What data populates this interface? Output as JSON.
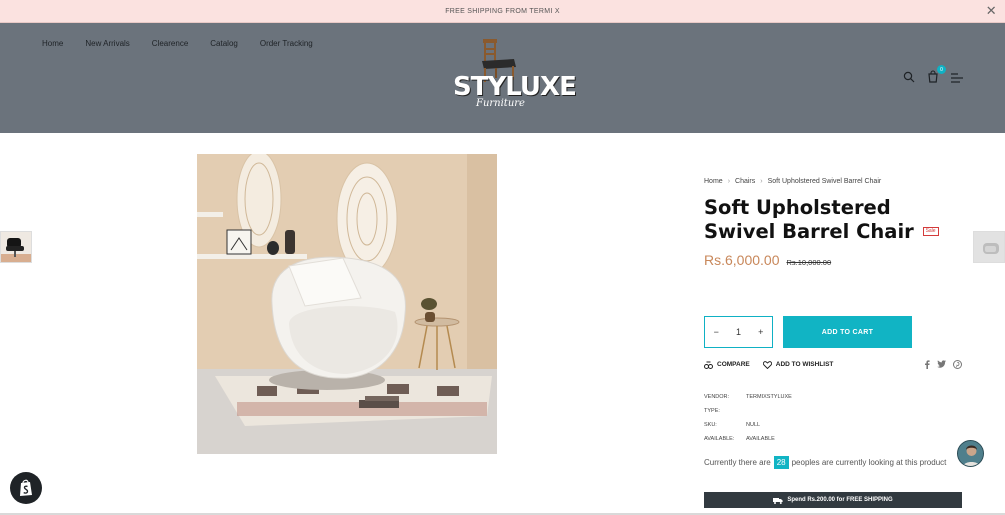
{
  "announcement": {
    "text": "FREE SHIPPING FROM TERMI X",
    "close_icon": "close-icon"
  },
  "nav": {
    "items": [
      "Home",
      "New Arrivals",
      "Clearence",
      "Catalog",
      "Order Tracking"
    ]
  },
  "logo": {
    "brand": "STYLUXE",
    "script": "Furniture"
  },
  "header_icons": {
    "search": "search-icon",
    "cart": "cart-icon",
    "cart_count": "0",
    "menu": "menu-icon"
  },
  "breadcrumb": {
    "home": "Home",
    "category": "Chairs",
    "current": "Soft Upholstered Swivel Barrel Chair"
  },
  "product": {
    "title": "Soft Upholstered Swivel Barrel Chair",
    "sale_badge": "Sale",
    "price": "Rs.6,000.00",
    "compare_price": "Rs.10,000.00",
    "quantity": "1",
    "add_to_cart": "ADD TO CART",
    "compare": "COMPARE",
    "wishlist": "ADD TO WISHLIST"
  },
  "meta": [
    {
      "key": "VENDOR:",
      "value": "TERMIXSTYLUXE"
    },
    {
      "key": "TYPE:",
      "value": ""
    },
    {
      "key": "SKU:",
      "value": "NULL"
    },
    {
      "key": "AVAILABLE:",
      "value": "AVAILABLE"
    }
  ],
  "viewers": {
    "prefix": "Currently there are",
    "count": "28",
    "suffix": "peoples are currently looking at this product"
  },
  "shipping": {
    "text": "Spend Rs.200.00 for FREE SHIPPING"
  },
  "colors": {
    "accent": "#11b4c4",
    "header_bg": "#6b737c",
    "announce_bg": "#fbe2e0",
    "price": "#c8875a",
    "ship_bar": "#323a40"
  }
}
